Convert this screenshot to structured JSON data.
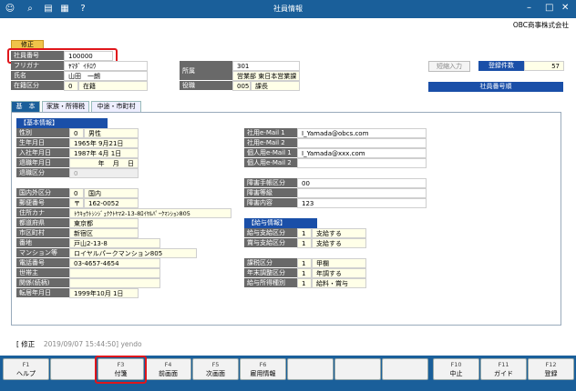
{
  "window": {
    "title": "社員情報",
    "company": "OBC商事株式会社"
  },
  "toolbar_icons": [
    "add-person-icon",
    "search-icon",
    "print-icon",
    "calculator-icon",
    "help-icon"
  ],
  "mode": "修正",
  "employee": {
    "id_label": "社員番号",
    "id_value": "100000",
    "kana_label": "フリガナ",
    "kana_value": "ﾔﾏﾀﾞ ｲﾁﾛｳ",
    "name_label": "氏名",
    "name_value": "山田　一朗",
    "status_label": "在籍区分",
    "status_code": "0",
    "status_value": "在籍",
    "dept_label": "所属",
    "dept_code": "301",
    "dept_value": "営業部 東日本営業課",
    "post_label": "役職",
    "post_code": "005",
    "post_value": "課長"
  },
  "side": {
    "short_input": "短縮入力",
    "count_label": "登録件数",
    "count_value": "57",
    "order_label": "社員番号順"
  },
  "tabs": [
    {
      "label": "基　本",
      "active": true
    },
    {
      "label": "家族・所得税",
      "active": false
    },
    {
      "label": "中途・市町村",
      "active": false
    }
  ],
  "basic": {
    "header": "【基本情報】",
    "rows": [
      {
        "label": "性別",
        "code": "0",
        "value": "男性"
      },
      {
        "label": "生年月日",
        "value": "1965年  9月21日"
      },
      {
        "label": "入社年月日",
        "value": "1987年  4月  1日"
      },
      {
        "label": "退職年月日",
        "value": "年　  月　  日"
      },
      {
        "label": "退職区分",
        "code": "0",
        "value": ""
      }
    ]
  },
  "address": {
    "rows": [
      {
        "label": "国内外区分",
        "code": "0",
        "value": "国内"
      },
      {
        "label": "郵便番号",
        "code": "〒",
        "value": "162-0052"
      },
      {
        "label": "住所カナ",
        "value": "ﾄｳｷｮｳﾄｼﾝｼﾞｭｸｸﾄﾔﾏ2-13-8ﾛｲﾔﾙﾊﾟｰｸﾏﾝｼｮﾝ805"
      },
      {
        "label": "都道府県",
        "value": "東京都"
      },
      {
        "label": "市区町村",
        "value": "新宿区"
      },
      {
        "label": "番地",
        "value": "戸山2-13-8"
      },
      {
        "label": "マンション等",
        "value": "ロイヤルパークマンション805"
      },
      {
        "label": "電話番号",
        "value": "03-4657-4654"
      },
      {
        "label": "世帯主",
        "value": ""
      },
      {
        "label": "関係(続柄)",
        "value": ""
      },
      {
        "label": "転居年月日",
        "value": "1999年10月  1日"
      }
    ]
  },
  "mail": {
    "rows": [
      {
        "label": "社用e-Mail 1",
        "value": "I_Yamada@obcs.com"
      },
      {
        "label": "社用e-Mail 2",
        "value": ""
      },
      {
        "label": "個人用e-Mail 1",
        "value": "I_Yamada@xxx.com"
      },
      {
        "label": "個人用e-Mail 2",
        "value": ""
      }
    ]
  },
  "disability": {
    "rows": [
      {
        "label": "障害手帳区分",
        "value": "00"
      },
      {
        "label": "障害等級",
        "value": ""
      },
      {
        "label": "障害内容",
        "value": "123"
      }
    ]
  },
  "salary": {
    "header": "【給与情報】",
    "rows": [
      {
        "label": "給与支給区分",
        "code": "1",
        "value": "支給する"
      },
      {
        "label": "賞与支給区分",
        "code": "1",
        "value": "支給する"
      }
    ]
  },
  "tax": {
    "rows": [
      {
        "label": "課税区分",
        "code": "1",
        "value": "甲欄"
      },
      {
        "label": "年末調整区分",
        "code": "1",
        "value": "年調する"
      },
      {
        "label": "給与所得種別",
        "code": "1",
        "value": "給料・賞与"
      }
    ]
  },
  "status": {
    "mode": "[ 修正",
    "timestamp": "2019/09/07 15:44:50] yendo"
  },
  "fkeys": [
    {
      "key": "F1",
      "name": "ヘルプ"
    },
    {
      "key": "",
      "name": ""
    },
    {
      "key": "F3",
      "name": "付箋"
    },
    {
      "key": "F4",
      "name": "前画面"
    },
    {
      "key": "F5",
      "name": "次画面"
    },
    {
      "key": "F6",
      "name": "雇用情報"
    },
    {
      "key": "",
      "name": ""
    },
    {
      "key": "",
      "name": ""
    },
    {
      "key": "",
      "name": ""
    },
    {
      "key": "F10",
      "name": "中止"
    },
    {
      "key": "F11",
      "name": "ガイド"
    },
    {
      "key": "F12",
      "name": "登録"
    }
  ]
}
